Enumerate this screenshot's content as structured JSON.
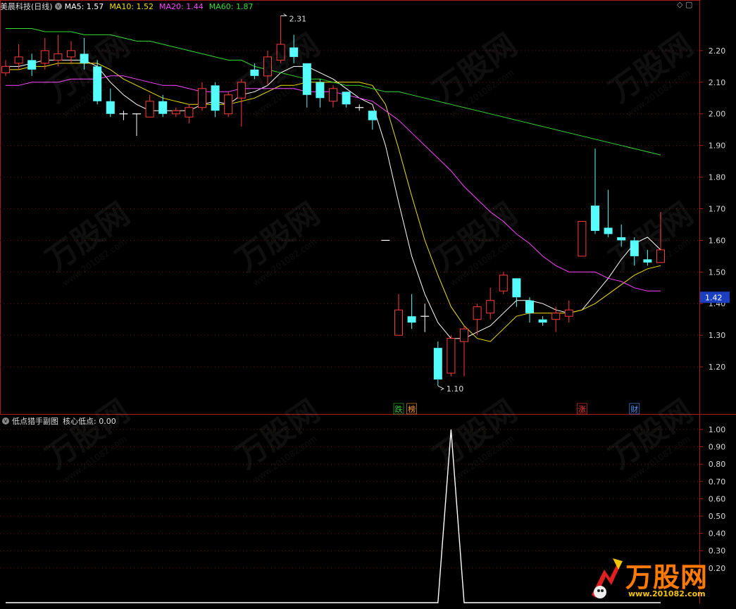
{
  "main_header": {
    "title": "美晨科技(日线)",
    "items": [
      {
        "label": "MA5: 1.57",
        "color": "#ffffff"
      },
      {
        "label": "MA10: 1.52",
        "color": "#f0e000"
      },
      {
        "label": "MA20: 1.44",
        "color": "#ff44ff"
      },
      {
        "label": "MA60: 1.87",
        "color": "#33dd33"
      }
    ]
  },
  "sub_header": {
    "title": "低点猎手副图",
    "items": [
      {
        "label": "核心低点: 0.00",
        "color": "#dddddd"
      }
    ]
  },
  "watermark": {
    "text": "万股网",
    "url": "www.201082.com"
  },
  "logo": {
    "text": "万股网",
    "url": "www.201082.com"
  },
  "chart_data": [
    {
      "type": "candlestick",
      "title": "美晨科技(日线)",
      "ylim": [
        1.1,
        2.32
      ],
      "yticks": [
        "2.20",
        "2.10",
        "2.00",
        "1.90",
        "1.80",
        "1.70",
        "1.60",
        "1.50",
        "1.40",
        "1.30",
        "1.20"
      ],
      "current_price": "1.42",
      "annotations": {
        "high": "2.31",
        "low": "1.10"
      },
      "markers": [
        {
          "label": "跌",
          "index": 30,
          "color": "#33cc33"
        },
        {
          "label": "榜",
          "index": 31,
          "color": "#ff9933"
        },
        {
          "label": "涨",
          "index": 44,
          "color": "#ff3333"
        },
        {
          "label": "财",
          "index": 48,
          "color": "#5599ff"
        }
      ],
      "colors": {
        "up": "#ff3a3a",
        "down": "#54fcfc",
        "flat": "#ffffff"
      },
      "candles": [
        {
          "o": 2.13,
          "c": 2.15,
          "h": 2.17,
          "l": 2.12
        },
        {
          "o": 2.16,
          "c": 2.18,
          "h": 2.22,
          "l": 2.14
        },
        {
          "o": 2.17,
          "c": 2.14,
          "h": 2.19,
          "l": 2.12
        },
        {
          "o": 2.16,
          "c": 2.2,
          "h": 2.24,
          "l": 2.14
        },
        {
          "o": 2.17,
          "c": 2.19,
          "h": 2.25,
          "l": 2.15
        },
        {
          "o": 2.18,
          "c": 2.2,
          "h": 2.23,
          "l": 2.16
        },
        {
          "o": 2.19,
          "c": 2.16,
          "h": 2.24,
          "l": 2.14
        },
        {
          "o": 2.15,
          "c": 2.04,
          "h": 2.17,
          "l": 2.03
        },
        {
          "o": 2.04,
          "c": 2.0,
          "h": 2.08,
          "l": 1.99
        },
        {
          "o": 2.0,
          "c": 2.0,
          "h": 2.01,
          "l": 1.98
        },
        {
          "o": 2.0,
          "c": 2.0,
          "h": 2.0,
          "l": 1.93
        },
        {
          "o": 1.99,
          "c": 2.04,
          "h": 2.06,
          "l": 1.99
        },
        {
          "o": 2.04,
          "c": 2.0,
          "h": 2.06,
          "l": 1.99
        },
        {
          "o": 2.0,
          "c": 2.01,
          "h": 2.02,
          "l": 1.99
        },
        {
          "o": 1.99,
          "c": 2.02,
          "h": 2.03,
          "l": 1.97
        },
        {
          "o": 2.02,
          "c": 2.08,
          "h": 2.1,
          "l": 2.01
        },
        {
          "o": 2.09,
          "c": 2.01,
          "h": 2.1,
          "l": 1.99
        },
        {
          "o": 2.0,
          "c": 2.06,
          "h": 2.07,
          "l": 1.99
        },
        {
          "o": 2.05,
          "c": 2.1,
          "h": 2.11,
          "l": 1.96
        },
        {
          "o": 2.14,
          "c": 2.12,
          "h": 2.16,
          "l": 2.11
        },
        {
          "o": 2.12,
          "c": 2.18,
          "h": 2.2,
          "l": 2.09
        },
        {
          "o": 2.17,
          "c": 2.22,
          "h": 2.31,
          "l": 2.16
        },
        {
          "o": 2.21,
          "c": 2.18,
          "h": 2.25,
          "l": 2.16
        },
        {
          "o": 2.16,
          "c": 2.06,
          "h": 2.16,
          "l": 2.02
        },
        {
          "o": 2.1,
          "c": 2.05,
          "h": 2.11,
          "l": 2.02
        },
        {
          "o": 2.04,
          "c": 2.08,
          "h": 2.09,
          "l": 2.02
        },
        {
          "o": 2.07,
          "c": 2.03,
          "h": 2.07,
          "l": 2.02
        },
        {
          "o": 2.02,
          "c": 2.02,
          "h": 2.03,
          "l": 2.01
        },
        {
          "o": 2.01,
          "c": 1.98,
          "h": 2.01,
          "l": 1.95
        },
        {
          "o": 1.6,
          "c": 1.6,
          "h": 1.6,
          "l": 1.6
        },
        {
          "o": 1.3,
          "c": 1.38,
          "h": 1.43,
          "l": 1.3
        },
        {
          "o": 1.36,
          "c": 1.34,
          "h": 1.43,
          "l": 1.32
        },
        {
          "o": 1.36,
          "c": 1.36,
          "h": 1.4,
          "l": 1.31
        },
        {
          "o": 1.26,
          "c": 1.16,
          "h": 1.28,
          "l": 1.14
        },
        {
          "o": 1.18,
          "c": 1.29,
          "h": 1.3,
          "l": 1.17
        },
        {
          "o": 1.28,
          "c": 1.32,
          "h": 1.33,
          "l": 1.17
        },
        {
          "o": 1.35,
          "c": 1.39,
          "h": 1.4,
          "l": 1.3
        },
        {
          "o": 1.37,
          "c": 1.41,
          "h": 1.45,
          "l": 1.35
        },
        {
          "o": 1.44,
          "c": 1.49,
          "h": 1.5,
          "l": 1.43
        },
        {
          "o": 1.48,
          "c": 1.42,
          "h": 1.48,
          "l": 1.39
        },
        {
          "o": 1.41,
          "c": 1.37,
          "h": 1.42,
          "l": 1.34
        },
        {
          "o": 1.35,
          "c": 1.34,
          "h": 1.36,
          "l": 1.33
        },
        {
          "o": 1.35,
          "c": 1.37,
          "h": 1.39,
          "l": 1.31
        },
        {
          "o": 1.36,
          "c": 1.38,
          "h": 1.41,
          "l": 1.34
        },
        {
          "o": 1.55,
          "c": 1.66,
          "h": 1.66,
          "l": 1.55
        },
        {
          "o": 1.71,
          "c": 1.63,
          "h": 1.89,
          "l": 1.62
        },
        {
          "o": 1.64,
          "c": 1.62,
          "h": 1.76,
          "l": 1.61
        },
        {
          "o": 1.61,
          "c": 1.6,
          "h": 1.65,
          "l": 1.58
        },
        {
          "o": 1.6,
          "c": 1.55,
          "h": 1.61,
          "l": 1.52
        },
        {
          "o": 1.54,
          "c": 1.53,
          "h": 1.57,
          "l": 1.52
        },
        {
          "o": 1.53,
          "c": 1.57,
          "h": 1.69,
          "l": 1.53
        }
      ],
      "ma": [
        {
          "name": "MA5",
          "color": "#ffffff",
          "values": [
            2.15,
            2.15,
            2.16,
            2.17,
            2.17,
            2.17,
            2.17,
            2.15,
            2.1,
            2.06,
            2.03,
            2.01,
            2.01,
            2.01,
            2.01,
            2.03,
            2.04,
            2.03,
            2.06,
            2.07,
            2.09,
            2.13,
            2.15,
            2.15,
            2.13,
            2.11,
            2.08,
            2.05,
            2.03,
            1.9,
            1.72,
            1.55,
            1.43,
            1.34,
            1.29,
            1.29,
            1.31,
            1.33,
            1.37,
            1.41,
            1.41,
            1.4,
            1.38,
            1.37,
            1.38,
            1.43,
            1.48,
            1.54,
            1.59,
            1.61,
            1.57
          ]
        },
        {
          "name": "MA10",
          "color": "#f0e000",
          "values": [
            2.14,
            2.14,
            2.15,
            2.15,
            2.16,
            2.16,
            2.16,
            2.16,
            2.14,
            2.11,
            2.09,
            2.07,
            2.05,
            2.04,
            2.03,
            2.03,
            2.03,
            2.03,
            2.04,
            2.05,
            2.07,
            2.09,
            2.09,
            2.1,
            2.1,
            2.1,
            2.1,
            2.1,
            2.09,
            2.03,
            1.89,
            1.74,
            1.6,
            1.49,
            1.39,
            1.33,
            1.29,
            1.28,
            1.32,
            1.36,
            1.37,
            1.37,
            1.37,
            1.37,
            1.38,
            1.4,
            1.43,
            1.46,
            1.49,
            1.51,
            1.52
          ]
        },
        {
          "name": "MA20",
          "color": "#ff44ff",
          "values": [
            2.09,
            2.09,
            2.1,
            2.1,
            2.1,
            2.11,
            2.11,
            2.11,
            2.12,
            2.12,
            2.11,
            2.1,
            2.09,
            2.09,
            2.08,
            2.07,
            2.07,
            2.07,
            2.08,
            2.08,
            2.08,
            2.08,
            2.08,
            2.07,
            2.07,
            2.07,
            2.06,
            2.05,
            2.04,
            2.01,
            1.98,
            1.94,
            1.9,
            1.86,
            1.82,
            1.77,
            1.73,
            1.69,
            1.66,
            1.62,
            1.59,
            1.55,
            1.52,
            1.5,
            1.5,
            1.5,
            1.48,
            1.47,
            1.45,
            1.44,
            1.44
          ]
        },
        {
          "name": "MA60",
          "color": "#33dd33",
          "values": [
            2.27,
            2.27,
            2.27,
            2.26,
            2.26,
            2.26,
            2.25,
            2.25,
            2.25,
            2.24,
            2.23,
            2.23,
            2.22,
            2.21,
            2.2,
            2.19,
            2.18,
            2.17,
            2.17,
            2.15,
            2.14,
            2.13,
            2.12,
            2.11,
            2.11,
            2.1,
            2.09,
            2.09,
            2.08,
            2.07,
            2.07,
            2.06,
            2.05,
            2.04,
            2.03,
            2.02,
            2.01,
            2.0,
            1.99,
            1.98,
            1.97,
            1.96,
            1.95,
            1.94,
            1.93,
            1.92,
            1.91,
            1.9,
            1.89,
            1.88,
            1.87
          ]
        }
      ]
    },
    {
      "type": "line",
      "title": "低点猎手副图",
      "series": [
        {
          "name": "核心低点",
          "color": "#ffffff",
          "values": [
            0,
            0,
            0,
            0,
            0,
            0,
            0,
            0,
            0,
            0,
            0,
            0,
            0,
            0,
            0,
            0,
            0,
            0,
            0,
            0,
            0,
            0,
            0,
            0,
            0,
            0,
            0,
            0,
            0,
            0,
            0,
            0,
            0,
            0,
            1,
            0,
            0,
            0,
            0,
            0,
            0,
            0,
            0,
            0,
            0,
            0,
            0,
            0,
            0,
            0,
            0
          ]
        }
      ],
      "ylim": [
        0,
        1.0
      ],
      "yticks": [
        "1.00",
        "0.90",
        "0.80",
        "0.70",
        "0.60",
        "0.50",
        "0.40",
        "0.30",
        "0.20"
      ]
    }
  ]
}
